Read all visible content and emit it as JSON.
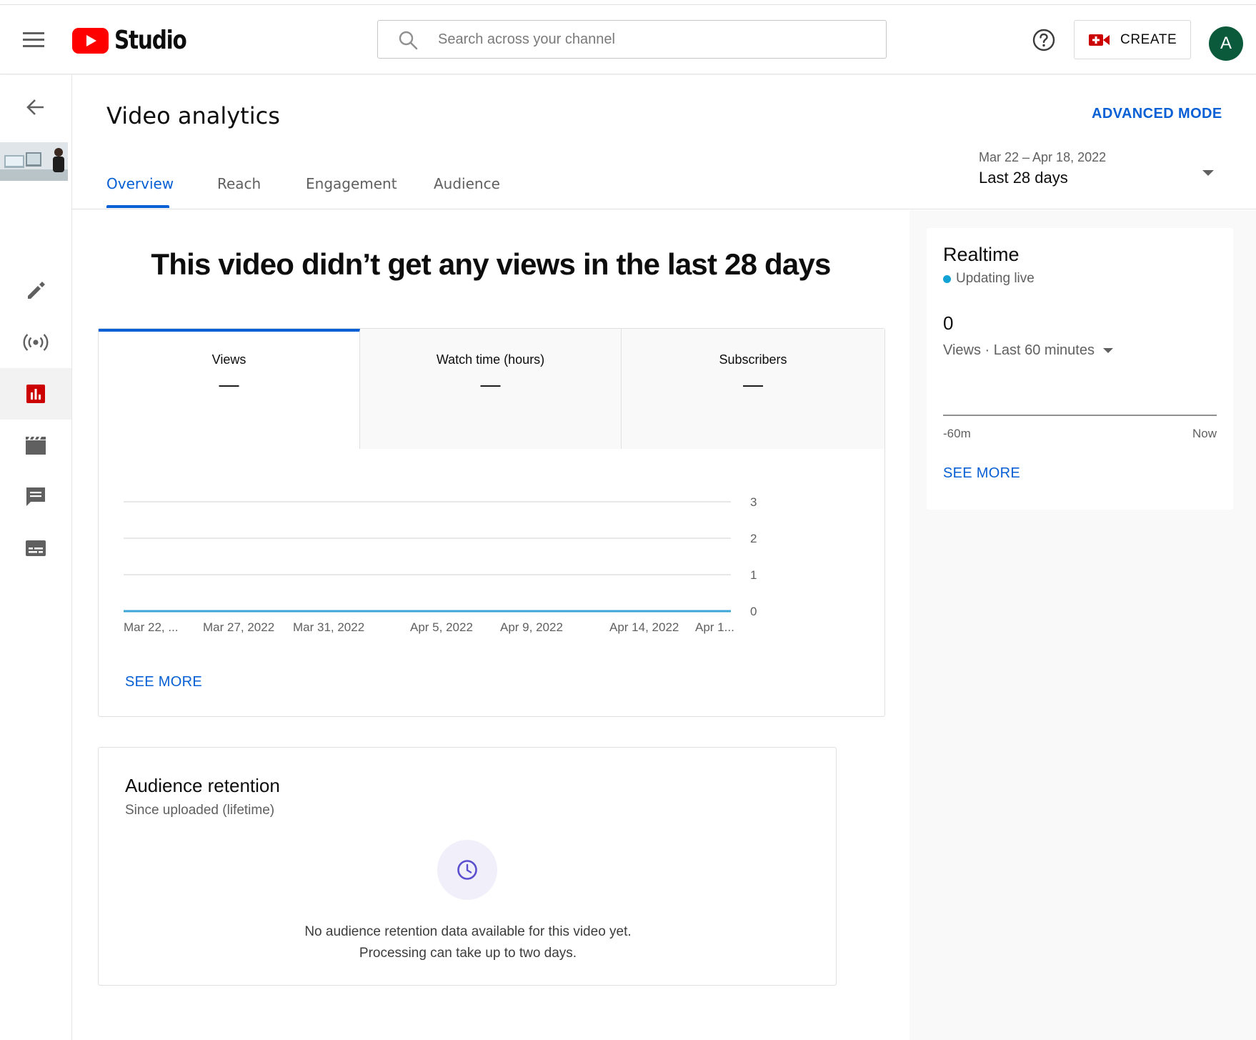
{
  "header": {
    "logo_text": "Studio",
    "search_placeholder": "Search across your channel",
    "create_label": "CREATE",
    "avatar_letter": "A"
  },
  "page": {
    "title": "Video analytics",
    "advanced_mode": "ADVANCED MODE",
    "tabs": [
      {
        "label": "Overview",
        "active": true
      },
      {
        "label": "Reach",
        "active": false
      },
      {
        "label": "Engagement",
        "active": false
      },
      {
        "label": "Audience",
        "active": false
      }
    ],
    "date_range": "Mar 22 – Apr 18, 2022",
    "date_label": "Last 28 days"
  },
  "headline": "This video didn’t get any views in the last 28 days",
  "metrics": [
    {
      "label": "Views",
      "value": "—",
      "active": true
    },
    {
      "label": "Watch time (hours)",
      "value": "—",
      "active": false
    },
    {
      "label": "Subscribers",
      "value": "—",
      "active": false
    }
  ],
  "chart_data": {
    "type": "line",
    "title": "",
    "xlabel": "",
    "ylabel": "",
    "x_tick_labels": [
      "Mar 22, ...",
      "Mar 27, 2022",
      "Mar 31, 2022",
      "Apr 5, 2022",
      "Apr 9, 2022",
      "Apr 14, 2022",
      "Apr 1..."
    ],
    "y_ticks": [
      0,
      1,
      2,
      3
    ],
    "ylim": [
      0,
      3
    ],
    "series": [
      {
        "name": "Views",
        "color": "#3ea6d6",
        "values": [
          0,
          0,
          0,
          0,
          0,
          0,
          0,
          0,
          0,
          0,
          0,
          0,
          0,
          0,
          0,
          0,
          0,
          0,
          0,
          0,
          0,
          0,
          0,
          0,
          0,
          0,
          0,
          0
        ]
      }
    ],
    "grid": true
  },
  "chart_see_more": "SEE MORE",
  "retention": {
    "title": "Audience retention",
    "subtitle": "Since uploaded (lifetime)",
    "message_line1": "No audience retention data available for this video yet.",
    "message_line2": "Processing can take up to two days."
  },
  "realtime": {
    "title": "Realtime",
    "status": "Updating live",
    "count": "0",
    "views_label": "Views · Last 60 minutes",
    "axis_left": "-60m",
    "axis_right": "Now",
    "see_more": "SEE MORE"
  },
  "colors": {
    "accent": "#065fd4",
    "brand_red": "#ff0000",
    "live_dot": "#12a3d4",
    "avatar": "#0a5a3b"
  },
  "icons": {
    "rail": [
      "back-arrow-icon",
      "video-thumbnail",
      "pencil-icon",
      "live-broadcast-icon",
      "analytics-icon",
      "clapperboard-icon",
      "comment-icon",
      "subtitles-icon"
    ]
  }
}
